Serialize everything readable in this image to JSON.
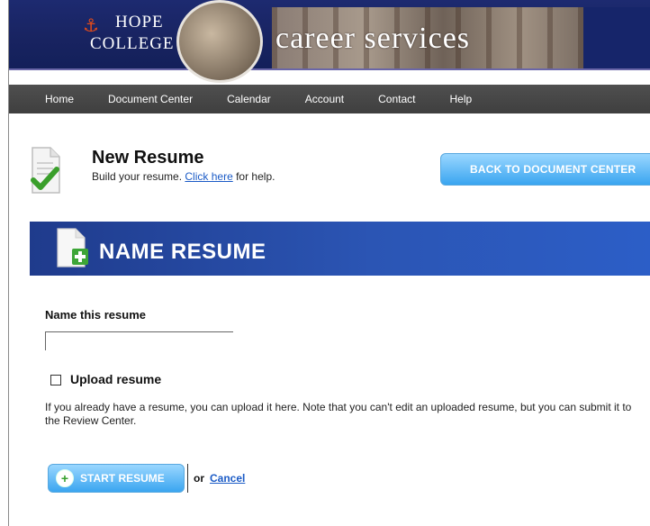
{
  "header": {
    "logo_line1": "HOPE",
    "logo_line2": "COLLEGE",
    "brand": "career services"
  },
  "nav": {
    "items": [
      "Home",
      "Document Center",
      "Calendar",
      "Account",
      "Contact",
      "Help"
    ]
  },
  "page": {
    "title": "New Resume",
    "subtitle_prefix": "Build your resume.",
    "subtitle_link": "Click here",
    "subtitle_suffix": "for help.",
    "back_button": "BACK TO DOCUMENT CENTER"
  },
  "section": {
    "title": "NAME RESUME"
  },
  "form": {
    "name_label": "Name this resume",
    "name_value": "",
    "upload_label": "Upload resume",
    "upload_checked": false,
    "help_text": "If you already have a resume, you can upload it here. Note that you can't edit an uploaded resume, but you can submit it to the Review Center.",
    "start_button": "START RESUME",
    "or_text": "or",
    "cancel_link": "Cancel"
  },
  "icons": {
    "doc_check": "document-check-icon",
    "doc_add": "document-add-icon",
    "plus_circle": "plus-circle-icon"
  },
  "colors": {
    "navy": "#1d2a70",
    "nav_bar": "#474747",
    "button_blue": "#3aa5f0",
    "section_blue": "#2b55b4",
    "link_blue": "#1b5bc6"
  }
}
